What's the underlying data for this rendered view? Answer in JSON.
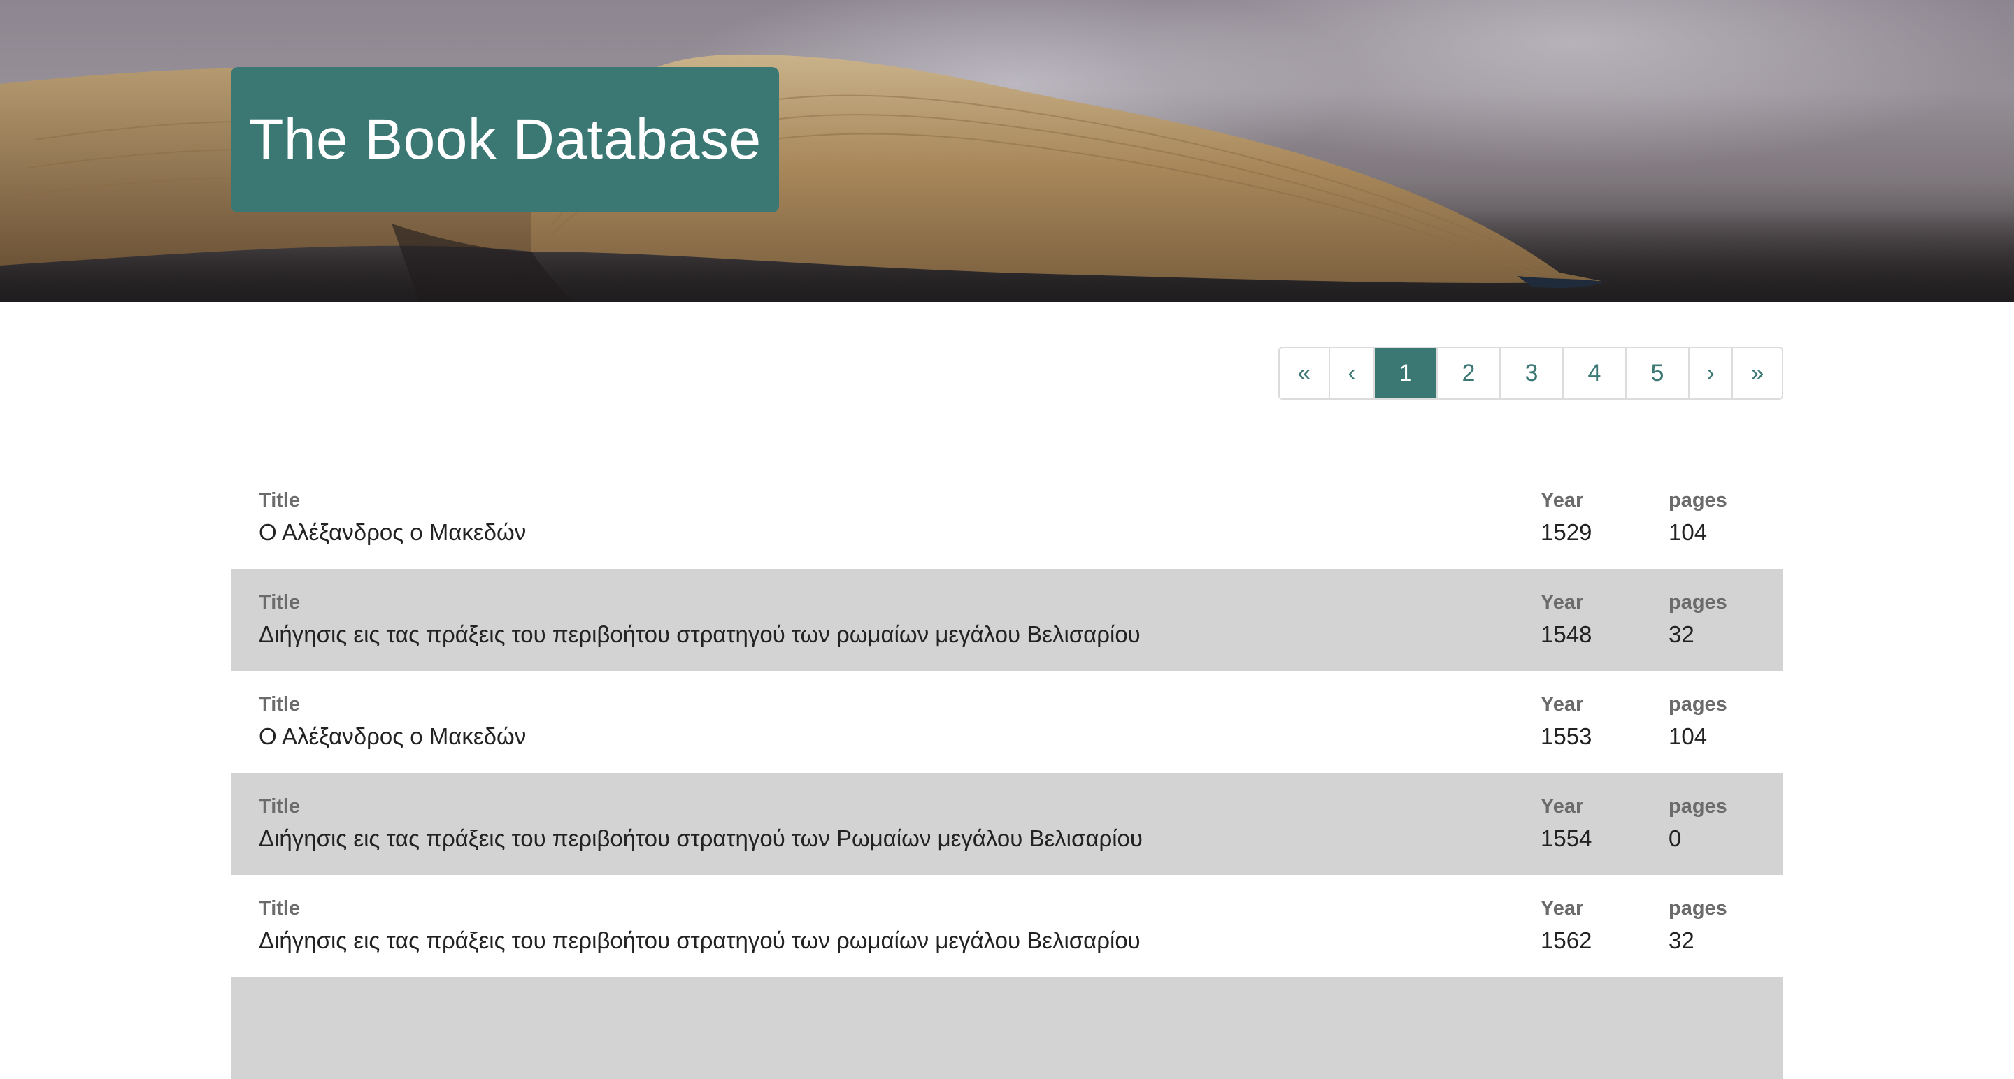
{
  "hero": {
    "title": "The Book Database"
  },
  "pagination": {
    "first": "«",
    "prev": "‹",
    "pages": [
      "1",
      "2",
      "3",
      "4",
      "5"
    ],
    "active_page": "1",
    "next": "›",
    "last": "»"
  },
  "books": {
    "labels": {
      "title": "Title",
      "year": "Year",
      "pages": "pages"
    },
    "rows": [
      {
        "title": "Ο Αλέξανδρος ο Μακεδών",
        "year": "1529",
        "pages": "104"
      },
      {
        "title": "Διήγησις εις τας πράξεις του περιβοήτου στρατηγού των ρωμαίων μεγάλου Βελισαρίου",
        "year": "1548",
        "pages": "32"
      },
      {
        "title": "Ο Αλέξανδρος ο Μακεδών",
        "year": "1553",
        "pages": "104"
      },
      {
        "title": "Διήγησις εις τας πράξεις του περιβοήτου στρατηγού των Ρωμαίων μεγάλου Βελισαρίου",
        "year": "1554",
        "pages": "0"
      },
      {
        "title": "Διήγησις εις τας πράξεις του περιβοήτου στρατηγού των ρωμαίων μεγάλου Βελισαρίου",
        "year": "1562",
        "pages": "32"
      }
    ]
  },
  "colors": {
    "accent": "#3b7874",
    "row_alt": "#d3d3d3",
    "label": "#6b6b6b",
    "text": "#222222"
  }
}
